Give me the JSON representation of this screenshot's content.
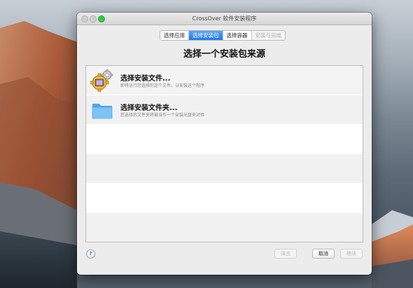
{
  "window": {
    "title": "CrossOver 软件安装程序"
  },
  "steps": [
    {
      "label": "选择应用",
      "state": "normal"
    },
    {
      "label": "选择安装包",
      "state": "active"
    },
    {
      "label": "选择容器",
      "state": "normal"
    },
    {
      "label": "安装与完成",
      "state": "disabled"
    }
  ],
  "heading": "选择一个安装包来源",
  "items": [
    {
      "title": "选择安装文件...",
      "subtitle": "即将运行您选择的这个文件，以安装这个程序",
      "icon": "installer-gear-icon"
    },
    {
      "title": "选择安装文件夹...",
      "subtitle": "您选择的文件夹将被当作一个安装光盘来对待",
      "icon": "folder-icon"
    }
  ],
  "footer": {
    "help_label": "?",
    "eject_label": "弹出",
    "cancel_label": "取消",
    "continue_label": "继续"
  },
  "colors": {
    "accent": "#2a83ee",
    "folder": "#5fb4f0"
  }
}
